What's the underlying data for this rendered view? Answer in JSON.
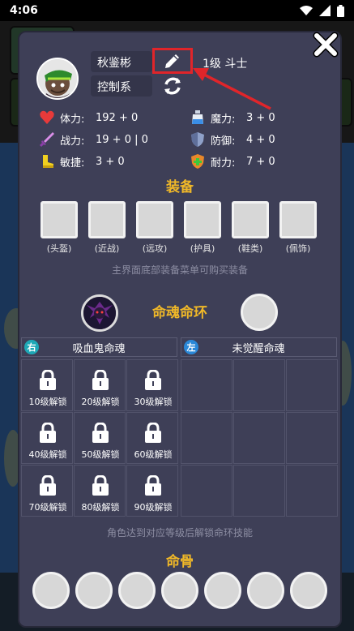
{
  "status_bar": {
    "time": "4:06"
  },
  "character": {
    "name": "秋鉴彬",
    "class": "控制系",
    "level": "1级 斗士"
  },
  "stats": [
    {
      "icon": "heart-icon",
      "label": "体力:",
      "value": "192 + 0"
    },
    {
      "icon": "potion-icon",
      "label": "魔力:",
      "value": "3 + 0"
    },
    {
      "icon": "sword-icon",
      "label": "战力:",
      "value": "19 + 0 | 0"
    },
    {
      "icon": "shield-icon",
      "label": "防御:",
      "value": "4 + 0"
    },
    {
      "icon": "boot-icon",
      "label": "敏捷:",
      "value": "3 + 0"
    },
    {
      "icon": "endurance-shield-icon",
      "label": "耐力:",
      "value": "7 + 0"
    }
  ],
  "equipment": {
    "title": "装备",
    "slots": [
      "(头盔)",
      "(近战)",
      "(远攻)",
      "(护具)",
      "(鞋类)",
      "(佩饰)"
    ],
    "hint": "主界面底部装备菜单可购买装备"
  },
  "soul_ring": {
    "title": "命魂命环",
    "right": {
      "badge": "右",
      "name": "吸血鬼命魂",
      "badge_color": "#1ea8b6"
    },
    "left": {
      "badge": "左",
      "name": "未觉醒命魂",
      "badge_color": "#2a88d8"
    },
    "locked_skills": [
      "10级解锁",
      "20级解锁",
      "30级解锁",
      "40级解锁",
      "50级解锁",
      "60级解锁",
      "70级解锁",
      "80级解锁",
      "90级解锁"
    ],
    "hint": "角色达到对应等级后解锁命环技能"
  },
  "soul_bone": {
    "title": "命骨",
    "slot_count": 7
  },
  "colors": {
    "panel": "#3e3f57",
    "accent_gold": "#f0b828",
    "highlight_red": "#e0252a"
  }
}
